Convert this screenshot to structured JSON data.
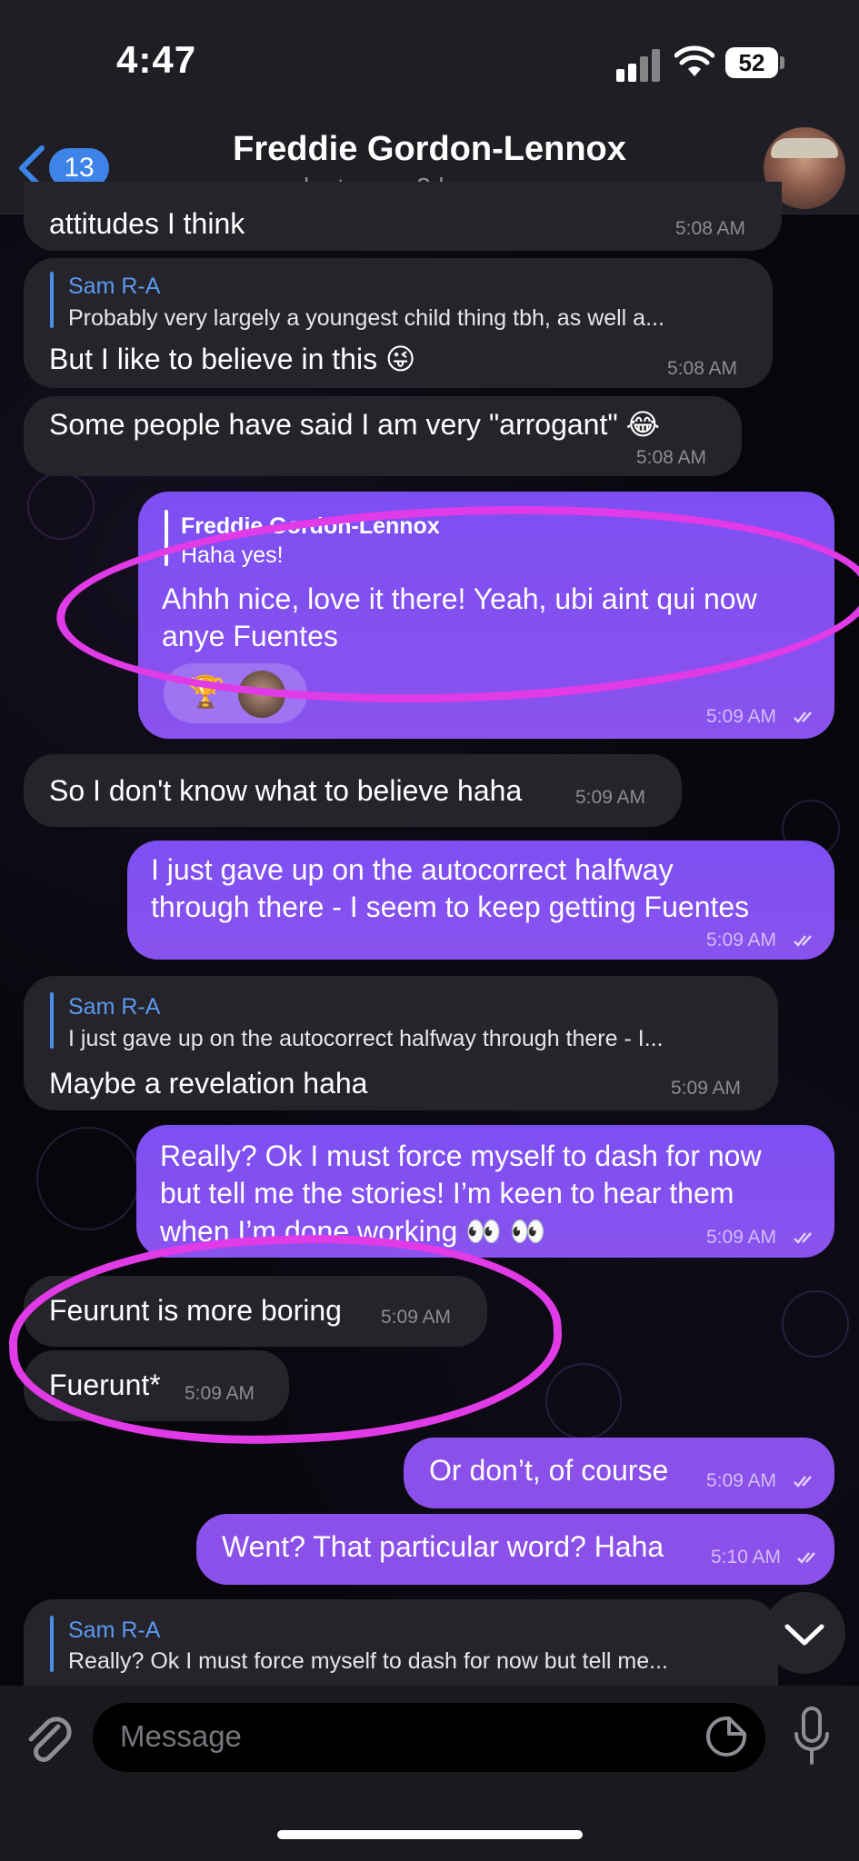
{
  "status_bar": {
    "time": "4:47",
    "battery": "52"
  },
  "header": {
    "back_count": "13",
    "contact_name": "Freddie Gordon-Lennox",
    "last_seen": "last seen 3 hours ago"
  },
  "messages": [
    {
      "id": "m1",
      "dir": "in",
      "text": "attitudes I think",
      "time": "5:08 AM"
    },
    {
      "id": "m2",
      "dir": "in",
      "reply_name": "Sam R-A",
      "reply_text": "Probably very largely a youngest child thing tbh, as well a...",
      "text": "But I like to believe in this 😜",
      "time": "5:08 AM"
    },
    {
      "id": "m3",
      "dir": "in",
      "text": "Some people have said I am very \"arrogant\" 😂",
      "time": "5:08 AM"
    },
    {
      "id": "m4",
      "dir": "out",
      "reply_name": "Freddie Gordon-Lennox",
      "reply_text": "Haha yes!",
      "text_line1": "Ahhh nice, love it there! Yeah, ubi aint qui now",
      "text_line2": "anye Fuentes",
      "reaction": "🏆",
      "time": "5:09 AM"
    },
    {
      "id": "m5",
      "dir": "in",
      "text": "So I don't know what to believe haha",
      "time": "5:09 AM"
    },
    {
      "id": "m6",
      "dir": "out",
      "text_line1": "I just gave up on the autocorrect halfway",
      "text_line2": "through there - I seem to keep getting Fuentes",
      "time": "5:09 AM"
    },
    {
      "id": "m7",
      "dir": "in",
      "reply_name": "Sam R-A",
      "reply_text": "I just gave up on the autocorrect halfway through there - I...",
      "text": "Maybe a revelation haha",
      "time": "5:09 AM"
    },
    {
      "id": "m8",
      "dir": "out",
      "text_line1": "Really? Ok I must force myself to dash for now",
      "text_line2": "but tell me the stories! I’m keen to hear them",
      "text_line3": "when I’m done working 👀 👀",
      "time": "5:09 AM"
    },
    {
      "id": "m9",
      "dir": "in",
      "text": "Feurunt is more boring",
      "time": "5:09 AM"
    },
    {
      "id": "m10",
      "dir": "in",
      "text": "Fuerunt*",
      "time": "5:09 AM"
    },
    {
      "id": "m11",
      "dir": "out",
      "text": "Or don’t, of course",
      "time": "5:09 AM"
    },
    {
      "id": "m12",
      "dir": "out",
      "text": "Went? That particular word? Haha",
      "time": "5:10 AM"
    },
    {
      "id": "m13",
      "dir": "in",
      "reply_name": "Sam R-A",
      "reply_text": "Really? Ok I must force myself to dash for now but tell me..."
    }
  ],
  "input": {
    "placeholder": "Message"
  },
  "colors": {
    "accent_blue": "#3d83e8",
    "outgoing": "#8052f0",
    "incoming": "#26242b",
    "highlight": "#e03be6"
  }
}
